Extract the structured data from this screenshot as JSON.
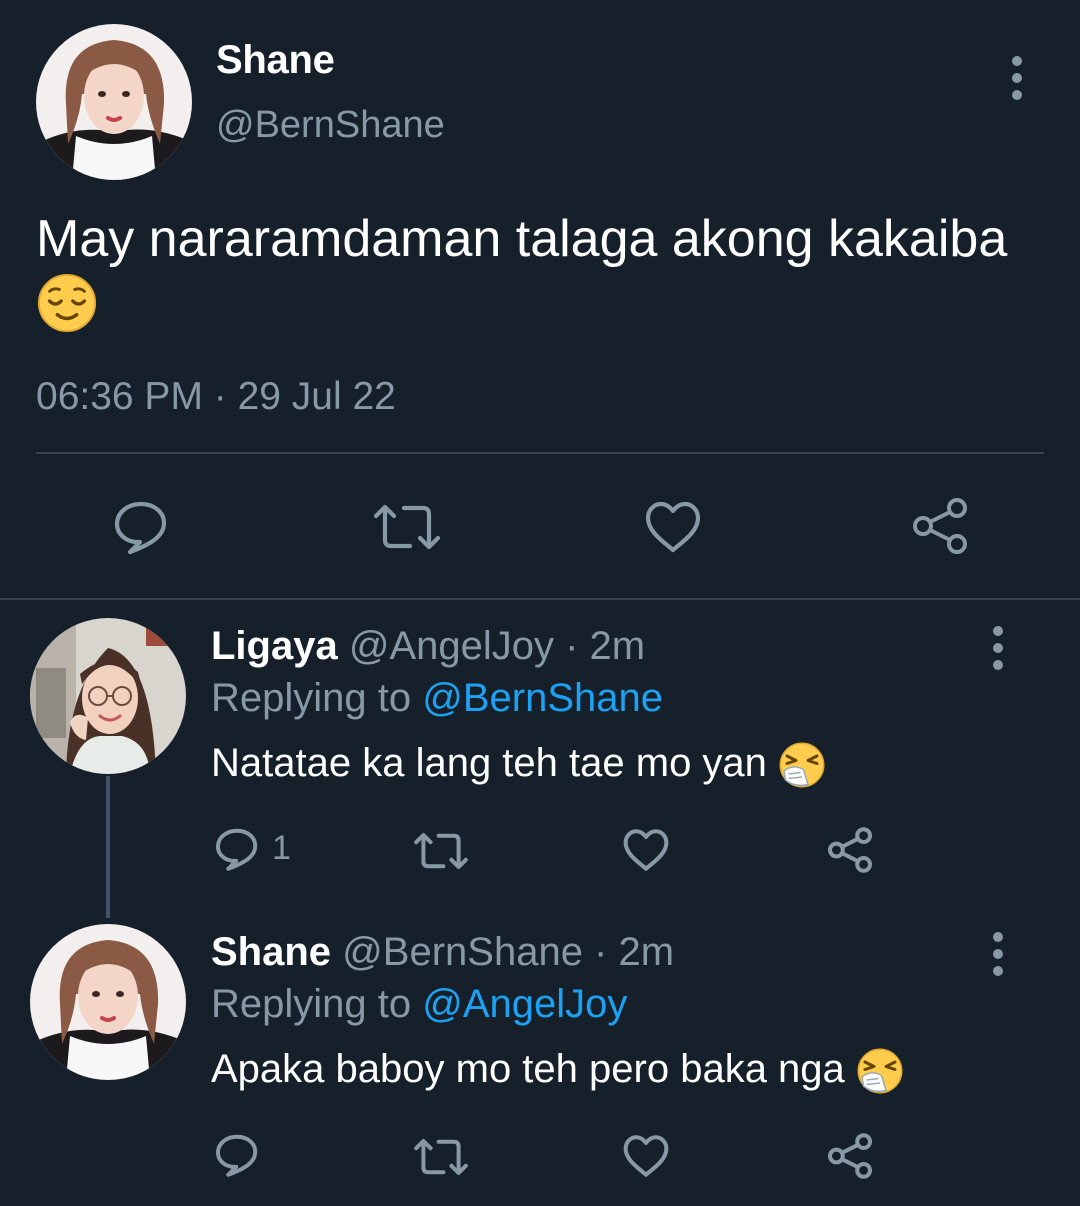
{
  "main_tweet": {
    "display_name": "Shane",
    "handle": "@BernShane",
    "text": "May nararamdaman talaga akong kakaiba",
    "emoji": "relieved-face",
    "timestamp": "06:36 PM · 29 Jul 22"
  },
  "replies": [
    {
      "display_name": "Ligaya",
      "handle": "@AngelJoy",
      "sep": " · ",
      "age": "2m",
      "replying_label": "Replying to",
      "replying_to": "@BernShane",
      "text": "Natatae ka lang teh tae mo yan",
      "emoji": "sneezing-face",
      "reply_count": "1"
    },
    {
      "display_name": "Shane",
      "handle": "@BernShane",
      "sep": " · ",
      "age": "2m",
      "replying_label": "Replying to",
      "replying_to": "@AngelJoy",
      "text": "Apaka baboy mo teh pero baka nga",
      "emoji": "sneezing-face",
      "reply_count": ""
    }
  ],
  "colors": {
    "background": "#15202b",
    "primary_text": "#ffffff",
    "secondary_text": "#8899a6",
    "accent": "#1da1f2",
    "divider": "#38444d"
  }
}
